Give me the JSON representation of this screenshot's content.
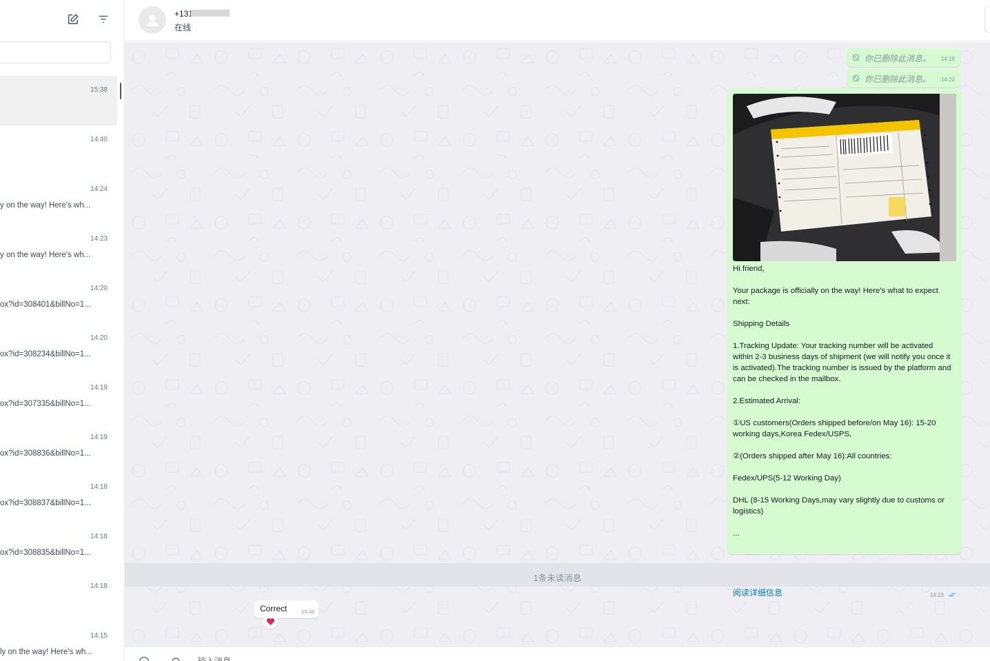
{
  "sidebar": {
    "search": {
      "placeholder": ""
    },
    "chats": [
      {
        "time": "15:38",
        "preview": "",
        "active": true
      },
      {
        "time": "14:40",
        "preview": ""
      },
      {
        "time": "14:24",
        "preview": "y on the way!  Here's wh..."
      },
      {
        "time": "14:23",
        "preview": "y on the way!  Here's wh..."
      },
      {
        "time": "14:20",
        "preview": "ox?id=308401&billNo=1..."
      },
      {
        "time": "14:20",
        "preview": "ox?id=308234&billNo=1..."
      },
      {
        "time": "14:19",
        "preview": "ox?id=307335&billNo=1..."
      },
      {
        "time": "14:19",
        "preview": "ox?id=308836&billNo=1..."
      },
      {
        "time": "14:18",
        "preview": "ox?id=308837&billNo=1..."
      },
      {
        "time": "14:18",
        "preview": "ox?id=308835&billNo=1..."
      },
      {
        "time": "14:18",
        "preview": ""
      },
      {
        "time": "14:15",
        "preview": "ly on the way!  Here's wh..."
      }
    ]
  },
  "header": {
    "contact_name": "+131",
    "status": "在线"
  },
  "messages": {
    "deleted": [
      {
        "text": "你已删除此消息。",
        "time": "14:18"
      },
      {
        "text": "你已删除此消息。",
        "time": "14:20"
      }
    ],
    "media": {
      "paragraphs": [
        "Hi friend,",
        "Your package is officially on the way!  Here's what to expect next:",
        "Shipping Details",
        "1.Tracking Update: Your tracking number will be activated within 2-3 business days of shipment (we will notify you once it is activated).The tracking number is issued by the platform and can be checked in the mailbox.",
        "2.Estimated Arrival:",
        "①US customers(Orders shipped before/on May 16): 15-20 working days,Korea Fedex/USPS,",
        "②(Orders shipped after May 16):All countries:",
        "Fedex/UPS(5-12 Working Day)",
        "DHL (8-15 Working Days,may vary slightly due to customs or logistics)",
        "..."
      ],
      "read_more": "阅读详细信息",
      "time": "14:23"
    },
    "unread_divider": "1条未读消息",
    "incoming": {
      "text": "Correct",
      "time": "15:38",
      "reaction": "heart"
    }
  },
  "composer": {
    "placeholder": "输入消息"
  },
  "colors": {
    "outgoing_bubble": "#d7fbd0",
    "chat_background": "#efeef3",
    "link": "#027eb5",
    "read_tick": "#53bdeb",
    "reaction_heart": "#e0245e"
  },
  "icons": [
    "new-chat-icon",
    "filter-icon",
    "avatar-placeholder-icon",
    "blocked-icon",
    "double-check-icon",
    "heart-icon",
    "emoji-icon",
    "attach-icon"
  ]
}
